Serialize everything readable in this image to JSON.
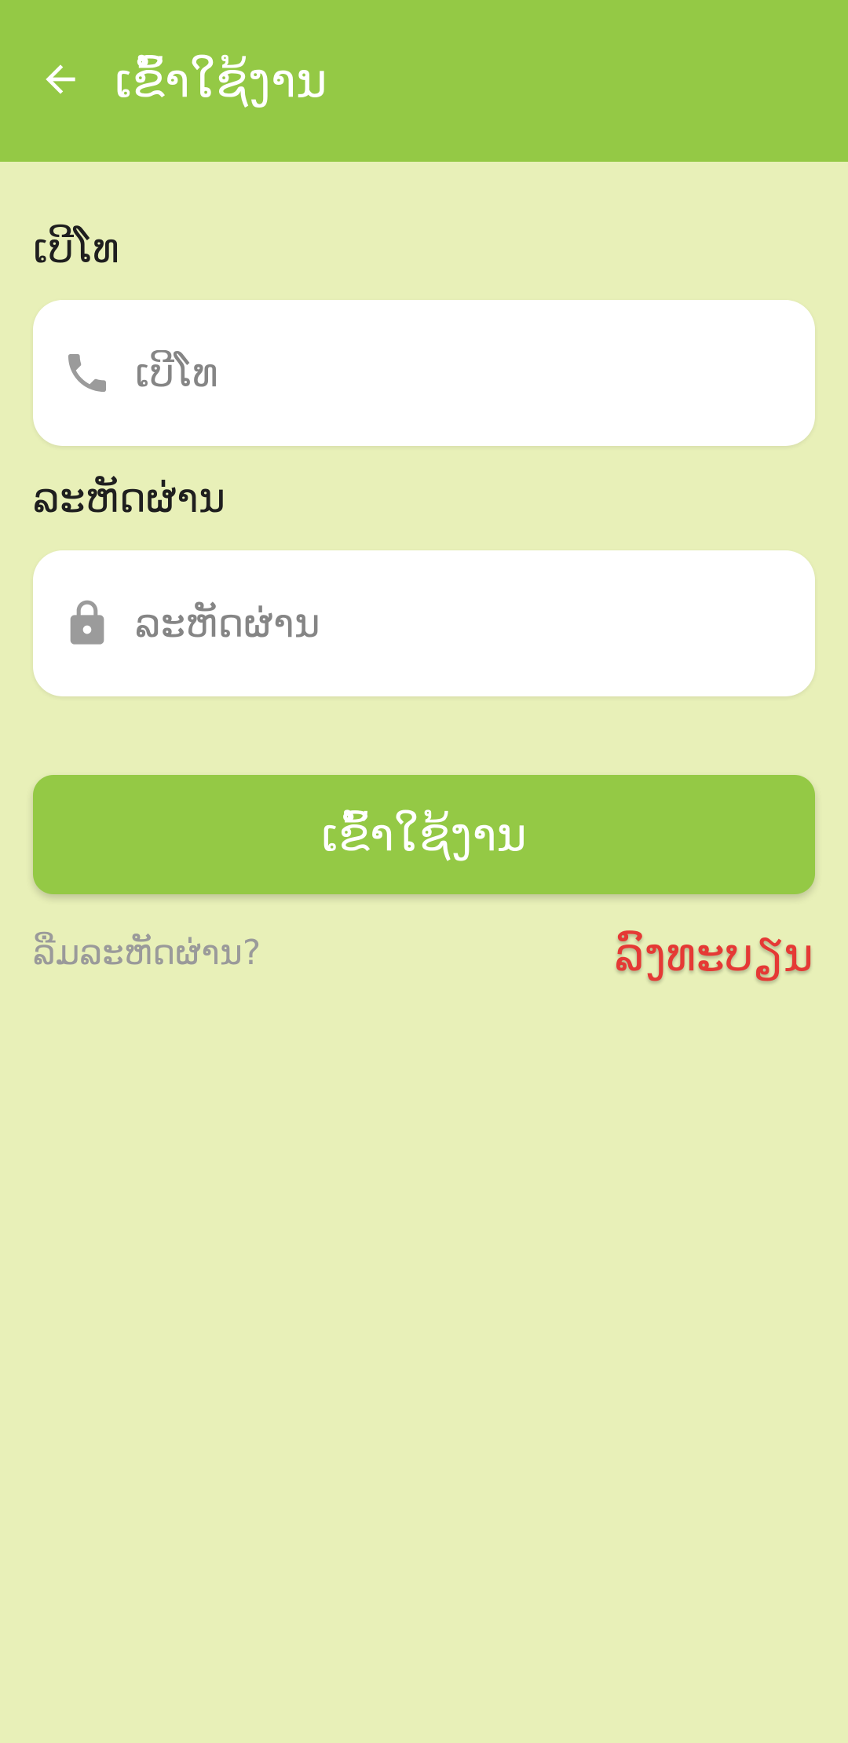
{
  "appbar": {
    "title": "ເຂົ້າໃຊ້ງານ",
    "back_icon": "arrow-back-icon",
    "color": "#94c945"
  },
  "form": {
    "phone": {
      "label": "ເບີໂທ",
      "placeholder": "ເບີໂທ",
      "value": "",
      "icon": "phone-icon"
    },
    "password": {
      "label": "ລະຫັດຜ່ານ",
      "placeholder": "ລະຫັດຜ່ານ",
      "value": "",
      "icon": "lock-icon"
    },
    "submit_label": "ເຂົ້າໃຊ້ງານ"
  },
  "links": {
    "forgot_password": "ລືມລະຫັດຜ່ານ?",
    "register": "ລົງທະບຽນ"
  },
  "colors": {
    "background": "#e8f0b8",
    "primary": "#94c945",
    "link_red": "#e53935",
    "muted": "#9a9a9a"
  }
}
